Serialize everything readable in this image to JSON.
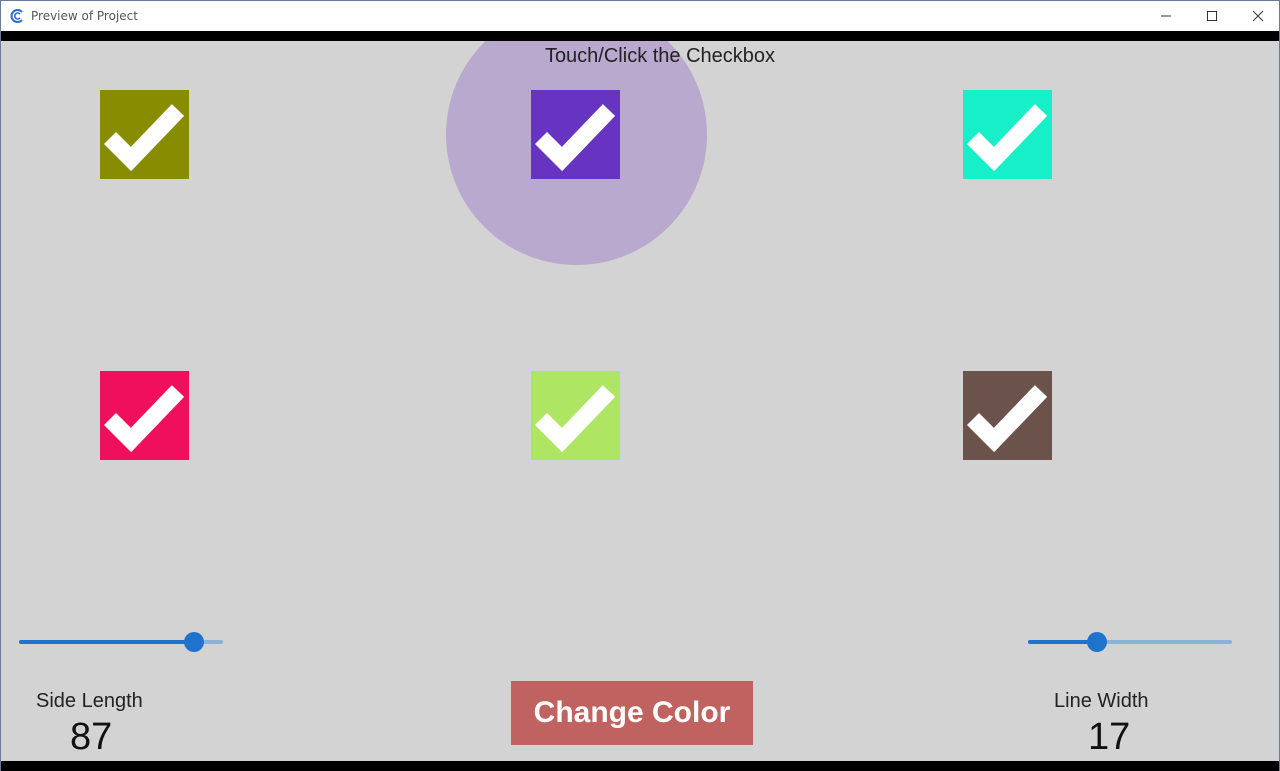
{
  "window": {
    "title": "Preview of Project",
    "controls": {
      "minimize_icon": "minimize-icon",
      "maximize_icon": "maximize-icon",
      "close_icon": "close-icon"
    }
  },
  "instruction": "Touch/Click the Checkbox",
  "checkboxes": [
    {
      "color": "#888c00",
      "checked": true
    },
    {
      "color": "#6634c1",
      "checked": true
    },
    {
      "color": "#16efc8",
      "checked": true
    },
    {
      "color": "#ef0f5d",
      "checked": true
    },
    {
      "color": "#aee563",
      "checked": true
    },
    {
      "color": "#6b534c",
      "checked": true
    }
  ],
  "ripple_color": "#b9a9cf",
  "controls": {
    "side_length": {
      "label": "Side Length",
      "value": "87",
      "slider_fraction": 0.86
    },
    "line_width": {
      "label": "Line Width",
      "value": "17",
      "slider_fraction": 0.34
    },
    "change_color_button": "Change Color"
  },
  "colors": {
    "background": "#d3d3d3",
    "slider_accent": "#1f73cc",
    "button_bg": "#c0625f"
  }
}
